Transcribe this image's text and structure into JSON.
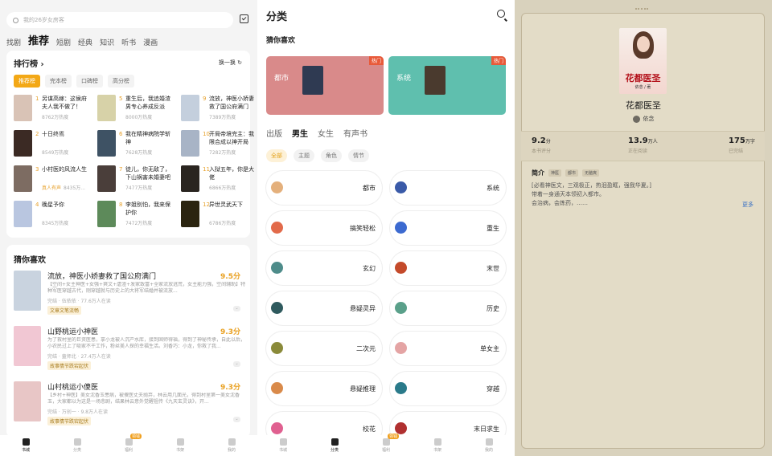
{
  "screen1": {
    "search_placeholder": "我的26岁女房客",
    "tabs": [
      "找剧",
      "推荐",
      "短剧",
      "经典",
      "知识",
      "听书",
      "漫画"
    ],
    "ranking": {
      "title": "排行榜",
      "switch": "换一换",
      "tabs": [
        "推荐榜",
        "完本榜",
        "口碑榜",
        "高分榜"
      ],
      "items": [
        {
          "no": "1",
          "title": "另谋高嫁：这侯府夫人我不做了！",
          "heat": "8762万热度",
          "color": "#d9c3b6"
        },
        {
          "no": "2",
          "title": "十日终焉",
          "heat": "8549万热度",
          "color": "#3b2a24"
        },
        {
          "no": "3",
          "title": "小村医的风流人生",
          "heat": "8435万...",
          "tag": "真人有声",
          "color": "#7d6c62"
        },
        {
          "no": "4",
          "title": "晚星予你",
          "heat": "8345万热度",
          "color": "#b9c6e0"
        },
        {
          "no": "5",
          "title": "重生后，我追婚渣男专心养成反派",
          "heat": "8000万热度",
          "color": "#d7d2a8"
        },
        {
          "no": "6",
          "title": "我在精神病院学斩神",
          "heat": "7628万热度",
          "color": "#3e5264"
        },
        {
          "no": "7",
          "title": "徒儿，你无敌了，下山祸害未婚妻吧",
          "heat": "7477万热度",
          "color": "#4a3e3a"
        },
        {
          "no": "8",
          "title": "李姐别怕，我来保护你",
          "heat": "7472万热度",
          "color": "#5d8a5a"
        },
        {
          "no": "9",
          "title": "流放，神医小娇妻救了国公府满门",
          "heat": "7389万热度",
          "color": "#c4cfdd"
        },
        {
          "no": "10",
          "title": "开局帝境完主：我限合成以神开局",
          "heat": "7282万热度",
          "color": "#a8b4c6"
        },
        {
          "no": "11",
          "title": "入狱五年，你是大佬",
          "heat": "6866万热度",
          "color": "#2a2520"
        },
        {
          "no": "12",
          "title": "异世灵武天下",
          "heat": "6786万热度",
          "color": "#2b2410"
        }
      ]
    },
    "guess": {
      "title": "猜你喜欢",
      "items": [
        {
          "title": "流放，神医小娇妻救了国公府满门",
          "score": "9.5分",
          "desc": "【空间+女主神医+女强+爽文+虐渣+发家致富+全家流放逃荒，女主能力强，空间辅助】特种军医穿越古代，刚穿越就与历史上的大将军结婚并被流放...",
          "meta": "完结 · 伍依依 · 77.6万人在读",
          "tag": "文章文笔流畅",
          "color": "#c9d3df"
        },
        {
          "title": "山野桃运小神医",
          "score": "9.3分",
          "desc": "为了救村里的巨资医患，拿小龙被人沉产水库，接到固师得福，得到了神秘传承，自此以后，小农民过上了吸家不干工作，粉丝美人探的幸福生活。刘香巧：小龙，你救了我...",
          "meta": "完结 · 童师北 · 27.4万人在读",
          "tag": "故事情节跌宕起伏",
          "color": "#f1c7d3"
        },
        {
          "title": "山村桃运小傻医",
          "score": "9.3分",
          "desc": "【乡村+神医】美女沈香玉患病，被傻医丈夫抛弃，林云用几面光，得到村里第一美女沈香玉，大家都以为这是一场悲剧，结果林云意外觉醒祖传《九天玄灵诀》，开...",
          "meta": "完结 · 万创一 · 9.8万人在读",
          "tag": "故事情节跌宕起伏",
          "color": "#e8c6c6"
        }
      ]
    },
    "nav": [
      {
        "label": "书城",
        "on": true
      },
      {
        "label": "分类",
        "on": false
      },
      {
        "label": "福利",
        "on": false,
        "badge": "领钱"
      },
      {
        "label": "书架",
        "on": false
      },
      {
        "label": "我的",
        "on": false
      }
    ]
  },
  "screen2": {
    "title": "分类",
    "section": "猜你喜欢",
    "banners": [
      {
        "label": "都市",
        "hot": "热门",
        "color": "#d98a8a"
      },
      {
        "label": "系统",
        "hot": "热门",
        "color": "#5fbfae"
      }
    ],
    "gender_tabs": [
      "出版",
      "男生",
      "女生",
      "有声书"
    ],
    "filter_tabs": [
      "全部",
      "主题",
      "角色",
      "情节"
    ],
    "categories": [
      {
        "name": "都市",
        "color": "#e4b07c"
      },
      {
        "name": "系统",
        "color": "#3a5aa8"
      },
      {
        "name": "搞笑轻松",
        "color": "#e26a4a"
      },
      {
        "name": "重生",
        "color": "#3c6ad0"
      },
      {
        "name": "玄幻",
        "color": "#4e8c8a"
      },
      {
        "name": "末世",
        "color": "#c44a2a"
      },
      {
        "name": "悬疑灵异",
        "color": "#2f5a5e"
      },
      {
        "name": "历史",
        "color": "#5aa08a"
      },
      {
        "name": "二次元",
        "color": "#8a8a3a"
      },
      {
        "name": "单女主",
        "color": "#e4a4a4"
      },
      {
        "name": "悬疑推理",
        "color": "#d98a4a"
      },
      {
        "name": "穿越",
        "color": "#2a7a8a"
      },
      {
        "name": "校花",
        "color": "#e06090"
      },
      {
        "name": "末日求生",
        "color": "#b03030"
      }
    ],
    "nav": [
      {
        "label": "书城",
        "on": false
      },
      {
        "label": "分类",
        "on": true
      },
      {
        "label": "福利",
        "on": false,
        "badge": "领钱"
      },
      {
        "label": "书架",
        "on": false
      },
      {
        "label": "我的",
        "on": false
      }
    ]
  },
  "screen3": {
    "cover_title": "花都医圣",
    "cover_author": "依念 / 著",
    "book_name": "花都医圣",
    "author": "依念",
    "stats": [
      {
        "value": "9.2",
        "unit": "分",
        "label": "本书评分"
      },
      {
        "value": "13.9",
        "unit": "万人",
        "label": "正在阅读"
      },
      {
        "value": "175",
        "unit": "万字",
        "label": "已完结"
      }
    ],
    "intro_title": "简介",
    "intro_tags": [
      "神医",
      "都市",
      "无脑爽"
    ],
    "desc_lines": [
      "[必看神医文，三观极正，热泪盈眶，强我华夏。]",
      "带着一身通天本领初入都市。",
      "会治病，会炼药，……"
    ],
    "more": "更多"
  }
}
